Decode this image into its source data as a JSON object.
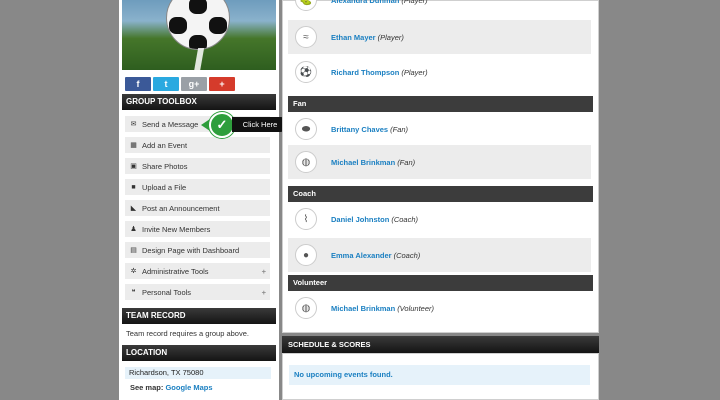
{
  "social": {
    "facebook": "f",
    "twitter": "t",
    "google": "g+",
    "more": "+"
  },
  "toolbox": {
    "header": "GROUP TOOLBOX",
    "items": [
      {
        "label": "Send a Message",
        "icon": "envelope-icon",
        "glyph": "✉"
      },
      {
        "label": "Add an Event",
        "icon": "calendar-icon",
        "glyph": "▦"
      },
      {
        "label": "Share Photos",
        "icon": "photo-icon",
        "glyph": "▣"
      },
      {
        "label": "Upload a File",
        "icon": "folder-icon",
        "glyph": "■"
      },
      {
        "label": "Post an Announcement",
        "icon": "rss-icon",
        "glyph": "◣"
      },
      {
        "label": "Invite New Members",
        "icon": "person-icon",
        "glyph": "♟"
      },
      {
        "label": "Design Page with Dashboard",
        "icon": "layout-icon",
        "glyph": "▤"
      },
      {
        "label": "Administrative Tools",
        "icon": "gear-icon",
        "glyph": "✲",
        "expand": "+"
      },
      {
        "label": "Personal Tools",
        "icon": "chat-icon",
        "glyph": "❝",
        "expand": "+"
      }
    ]
  },
  "callout": {
    "label": "Click Here",
    "check": "✓"
  },
  "team_record": {
    "header": "TEAM RECORD",
    "text": "Team record requires a group above."
  },
  "location": {
    "header": "LOCATION",
    "address": "Richardson, TX 75080",
    "see_map": "See map:",
    "map_link": "Google Maps"
  },
  "roster": {
    "players": [
      {
        "name": "Alexandra Dunman",
        "role": "(Player)",
        "icon": "golf-icon",
        "glyph": "⛳"
      },
      {
        "name": "Ethan Mayer",
        "role": "(Player)",
        "icon": "swim-icon",
        "glyph": "≈"
      },
      {
        "name": "Richard Thompson",
        "role": "(Player)",
        "icon": "soccer-ball-icon",
        "glyph": "⚽"
      }
    ],
    "fan_header": "Fan",
    "fans": [
      {
        "name": "Brittany Chaves",
        "role": "(Fan)",
        "icon": "hockey-puck-icon",
        "glyph": "⬬"
      },
      {
        "name": "Michael Brinkman",
        "role": "(Fan)",
        "icon": "volleyball-icon",
        "glyph": "◍"
      }
    ],
    "coach_header": "Coach",
    "coaches": [
      {
        "name": "Daniel Johnston",
        "role": "(Coach)",
        "icon": "skate-icon",
        "glyph": "⌇"
      },
      {
        "name": "Emma Alexander",
        "role": "(Coach)",
        "icon": "bowling-icon",
        "glyph": "●"
      }
    ],
    "volunteer_header": "Volunteer",
    "volunteers": [
      {
        "name": "Michael Brinkman",
        "role": "(Volunteer)",
        "icon": "volleyball-icon",
        "glyph": "◍"
      }
    ]
  },
  "schedule": {
    "header": "SCHEDULE & SCORES",
    "empty": "No upcoming events found."
  }
}
